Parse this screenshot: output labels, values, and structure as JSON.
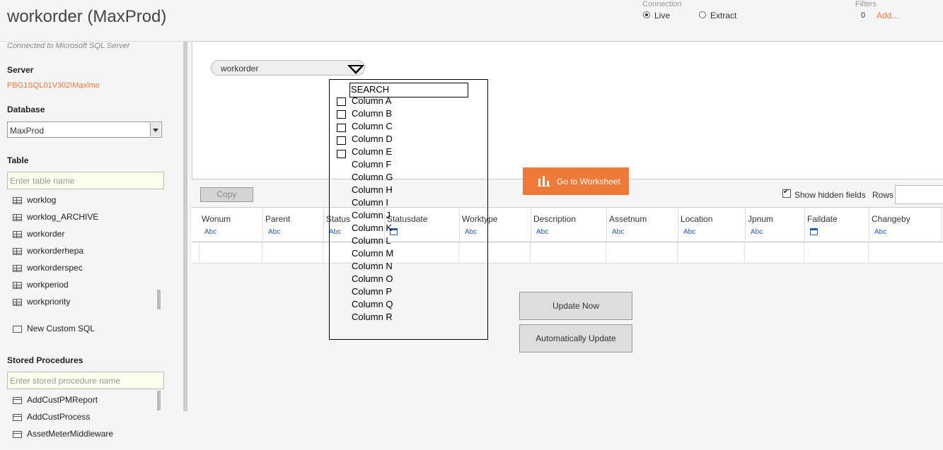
{
  "header": {
    "title": "workorder (MaxProd)",
    "connection_label": "Connection",
    "connection_options": [
      {
        "label": "Live",
        "selected": true
      },
      {
        "label": "Extract",
        "selected": false
      }
    ],
    "filters_label": "Filters",
    "filters_count": "0",
    "filters_add": "Add..."
  },
  "sidebar": {
    "connected_text": "Connected to Microsoft SQL Server",
    "server_heading": "Server",
    "server_value": "PBG1SQL01V302\\Maximo",
    "database_heading": "Database",
    "database_value": "MaxProd",
    "table_heading": "Table",
    "table_search_placeholder": "Enter table name",
    "tables": [
      "worklog",
      "worklog_ARCHIVE",
      "workorder",
      "workorderhepa",
      "workorderspec",
      "workperiod",
      "workpriority"
    ],
    "new_custom_sql": "New Custom SQL",
    "stored_procedures_heading": "Stored Procedures",
    "sp_search_placeholder": "Enter stored procedure name",
    "stored_procedures": [
      "AddCustPMReport",
      "AddCustProcess",
      "AssetMeterMiddleware"
    ]
  },
  "canvas": {
    "table_pill": "workorder"
  },
  "toolbar": {
    "copy_label": "Copy",
    "go_to_worksheet": "Go to Worksheet",
    "show_hidden_fields": "Show hidden fields",
    "rows_label": "Rows"
  },
  "grid": {
    "columns": [
      {
        "name": "Wonum",
        "type": "Abc"
      },
      {
        "name": "Parent",
        "type": "Abc"
      },
      {
        "name": "Status",
        "type": "Abc"
      },
      {
        "name": "Statusdate",
        "type": "date"
      },
      {
        "name": "Worktype",
        "type": "Abc"
      },
      {
        "name": "Description",
        "type": "Abc"
      },
      {
        "name": "Assetnum",
        "type": "Abc"
      },
      {
        "name": "Location",
        "type": "Abc"
      },
      {
        "name": "Jpnum",
        "type": "Abc"
      },
      {
        "name": "Faildate",
        "type": "date"
      },
      {
        "name": "Changeby",
        "type": "Abc"
      }
    ],
    "update_now": "Update Now",
    "automatically_update": "Automatically Update"
  },
  "dropdown": {
    "search": "SEARCH",
    "items": [
      "Column A",
      "Column B",
      "Column C",
      "Column D",
      "Column E",
      "Column F",
      "Column G",
      "Column H",
      "Column I",
      "Column J",
      "Column K",
      "Column L",
      "Column M",
      "Column N",
      "Column O",
      "Column P",
      "Column Q",
      "Column R"
    ]
  },
  "colors": {
    "accent": "#ee7a3a",
    "link": "#e8763a",
    "type_blue": "#2a5caa"
  }
}
